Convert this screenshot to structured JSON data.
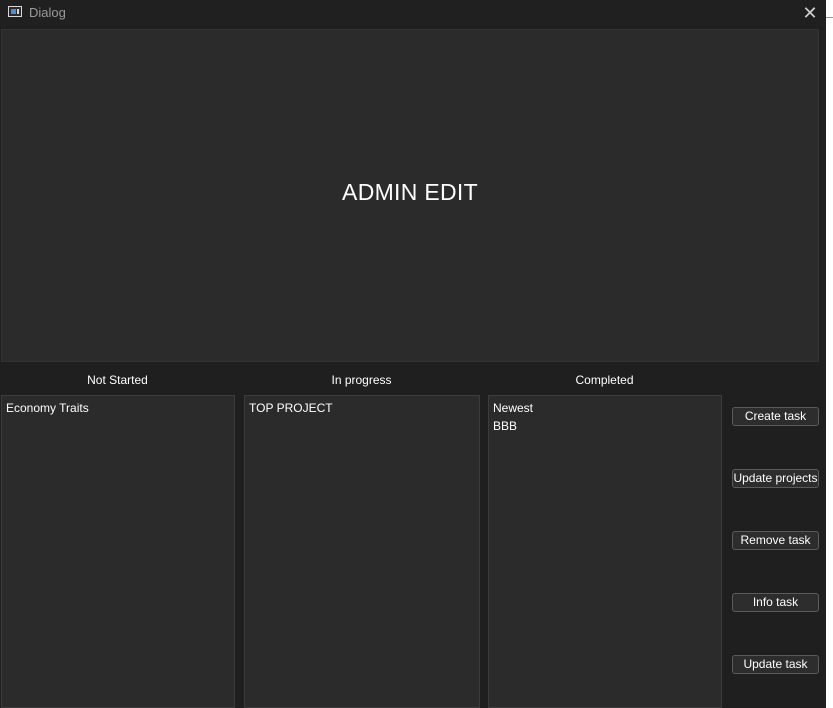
{
  "window": {
    "title": "Dialog",
    "close_glyph": "✕"
  },
  "header": {
    "title": "ADMIN EDIT"
  },
  "columns": [
    {
      "label": "Not Started",
      "items": [
        "Economy Traits"
      ]
    },
    {
      "label": "In progress",
      "items": [
        "TOP PROJECT"
      ]
    },
    {
      "label": "Completed",
      "items": [
        "Newest",
        "BBB"
      ]
    }
  ],
  "buttons": {
    "create": "Create  task",
    "update_projects": "Update projects",
    "remove": "Remove  task",
    "info": "Info task",
    "update": "Update  task"
  },
  "icons": {
    "app": "window-app-icon",
    "close": "close-icon"
  },
  "colors": {
    "window_bg": "#1f1f1f",
    "panel_bg": "#2b2b2b",
    "text": "#ffffff",
    "title_text": "#9a9a9a"
  }
}
